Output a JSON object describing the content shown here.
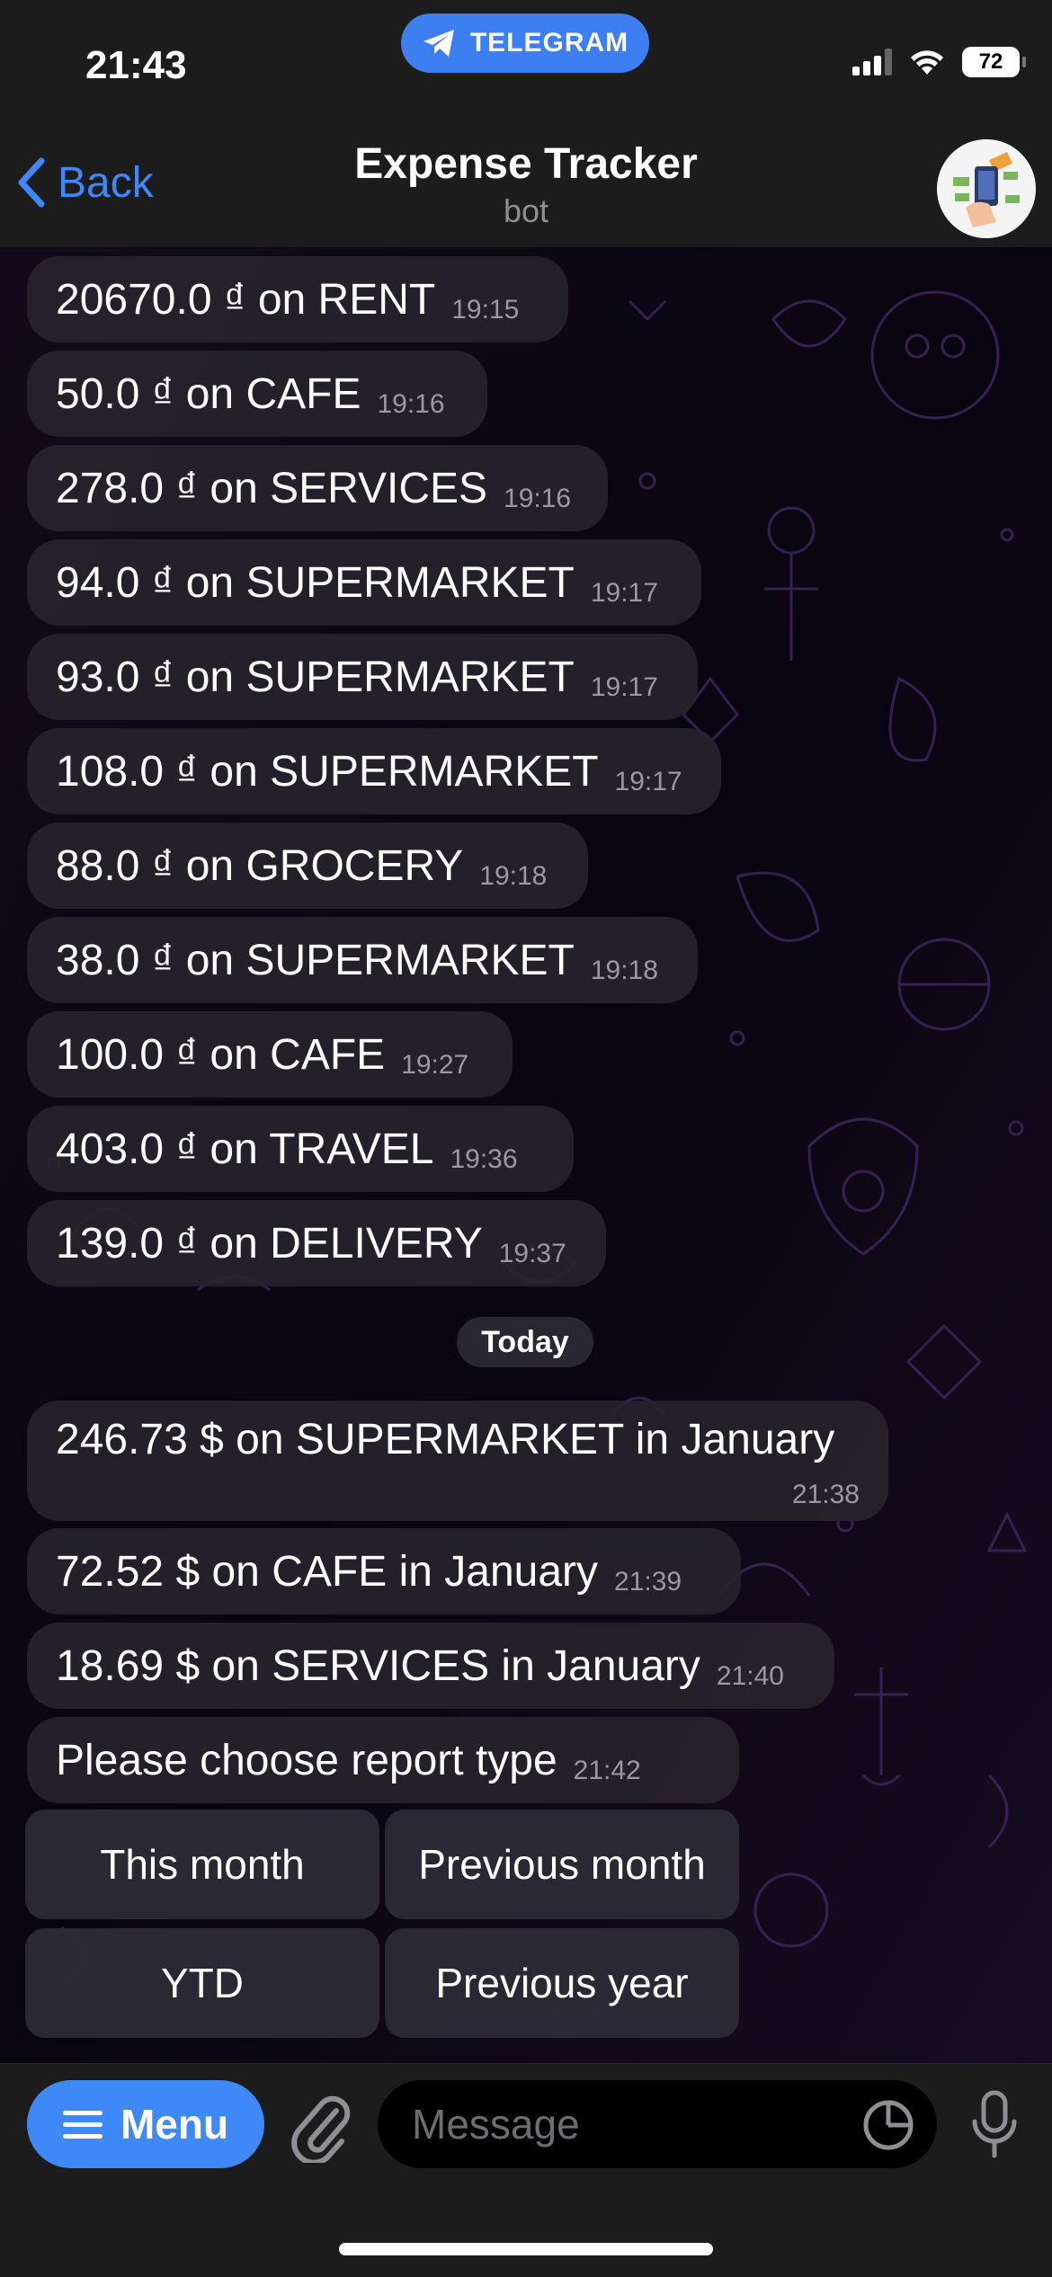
{
  "status_bar": {
    "time": "21:43",
    "telegram_label": "TELEGRAM",
    "battery": "72"
  },
  "header": {
    "back_label": "Back",
    "title": "Expense Tracker",
    "subtitle": "bot"
  },
  "messages": [
    {
      "text": "20670.0 ₫ on RENT",
      "time": "19:15"
    },
    {
      "text": "50.0 ₫ on CAFE",
      "time": "19:16"
    },
    {
      "text": "278.0 ₫ on SERVICES",
      "time": "19:16"
    },
    {
      "text": "94.0 ₫ on SUPERMARKET",
      "time": "19:17"
    },
    {
      "text": "93.0 ₫ on SUPERMARKET",
      "time": "19:17"
    },
    {
      "text": "108.0 ₫ on SUPERMARKET",
      "time": "19:17"
    },
    {
      "text": "88.0 ₫ on GROCERY",
      "time": "19:18"
    },
    {
      "text": "38.0 ₫ on SUPERMARKET",
      "time": "19:18"
    },
    {
      "text": "100.0 ₫ on CAFE",
      "time": "19:27"
    },
    {
      "text": "403.0 ₫ on TRAVEL",
      "time": "19:36"
    },
    {
      "text": "139.0 ₫ on DELIVERY",
      "time": "19:37"
    }
  ],
  "date_separator": "Today",
  "today_messages": [
    {
      "text": "246.73 $ on SUPERMARKET in January",
      "time": "21:38"
    },
    {
      "text": "72.52 $ on CAFE in January",
      "time": "21:39"
    },
    {
      "text": "18.69 $ on SERVICES in January",
      "time": "21:40"
    },
    {
      "text": "Please choose report type",
      "time": "21:42"
    }
  ],
  "keyboard": {
    "this_month": "This month",
    "previous_month": "Previous month",
    "ytd": "YTD",
    "previous_year": "Previous year"
  },
  "input_bar": {
    "menu_label": "Menu",
    "message_placeholder": "Message"
  },
  "colors": {
    "accent": "#3e88f7",
    "bubble": "#26222c",
    "timestamp": "#9b97a3"
  }
}
